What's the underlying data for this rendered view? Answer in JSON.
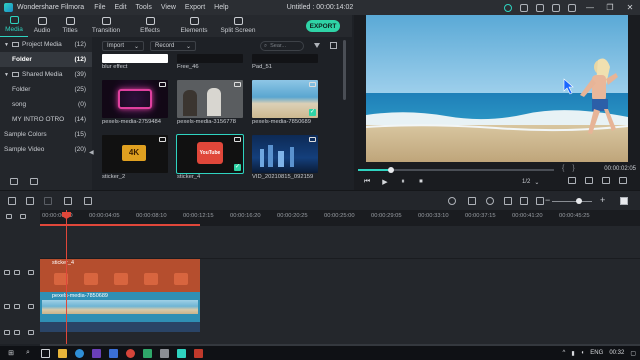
{
  "titlebar": {
    "app_name": "Wondershare Filmora",
    "menu": [
      "File",
      "Edit",
      "Tools",
      "View",
      "Export",
      "Help"
    ],
    "document_title": "Untitled : 00:00:14:02",
    "window_controls": [
      "—",
      "❐",
      "✕"
    ]
  },
  "tool_tabs": [
    {
      "label": "Media",
      "icon": "media-icon",
      "active": true
    },
    {
      "label": "Audio",
      "icon": "music-note-icon",
      "active": false
    },
    {
      "label": "Titles",
      "icon": "text-t-icon",
      "active": false
    },
    {
      "label": "Transition",
      "icon": "transition-icon",
      "active": false
    },
    {
      "label": "Effects",
      "icon": "effects-icon",
      "active": false
    },
    {
      "label": "Elements",
      "icon": "elements-icon",
      "active": false
    },
    {
      "label": "Split Screen",
      "icon": "split-screen-icon",
      "active": false
    }
  ],
  "export_label": "EXPORT",
  "sidebar": {
    "items": [
      {
        "label": "Project Media",
        "count": "(12)"
      },
      {
        "label": "Folder",
        "count": "(12)"
      },
      {
        "label": "Shared Media",
        "count": "(39)"
      },
      {
        "label": "Folder",
        "count": "(25)"
      },
      {
        "label": "song",
        "count": "(0)"
      },
      {
        "label": "MY INTRO OTRO",
        "count": "(14)"
      },
      {
        "label": "Sample Colors",
        "count": "(15)"
      },
      {
        "label": "Sample Video",
        "count": "(20)"
      }
    ]
  },
  "media_toolbar": {
    "import_label": "Import",
    "record_label": "Record",
    "search_placeholder": "Sear..."
  },
  "media_items": [
    {
      "label": "blur effect"
    },
    {
      "label": "Free_46"
    },
    {
      "label": "Pad_51"
    },
    {
      "label": "pexels-media-2759484"
    },
    {
      "label": "pexels-media-3156778"
    },
    {
      "label": "pexels-media-7850689"
    },
    {
      "label": "sticker_2",
      "thumb_text": "4K"
    },
    {
      "label": "sticker_4",
      "thumb_text": "YouTube"
    },
    {
      "label": "VID_20210815_092159"
    }
  ],
  "preview": {
    "progress_fraction": 0.17,
    "timecode": "00:00:02:05",
    "quality": "1/2",
    "controls": [
      "⏮",
      "▶",
      "⏸",
      "⏹"
    ]
  },
  "timeline": {
    "ruler_ticks": [
      "00:00:00:00",
      "00:00:04:05",
      "00:00:08:10",
      "00:00:12:15",
      "00:00:16:20",
      "00:00:20:25",
      "00:00:25:00",
      "00:00:29:05",
      "00:00:33:10",
      "00:00:37:15",
      "00:00:41:20",
      "00:00:45:25"
    ],
    "sticker_clip_label": "sticker_4",
    "video_clip_label": "pexels-media-7850689"
  },
  "taskbar": {
    "lang": "ENG",
    "time": "00:32"
  },
  "colors": {
    "accent": "#2fd3c0",
    "export": "#2fd3a6",
    "playhead": "#e0473a",
    "sticker_clip": "#b54e2e",
    "video_clip": "#2f8fb4"
  }
}
